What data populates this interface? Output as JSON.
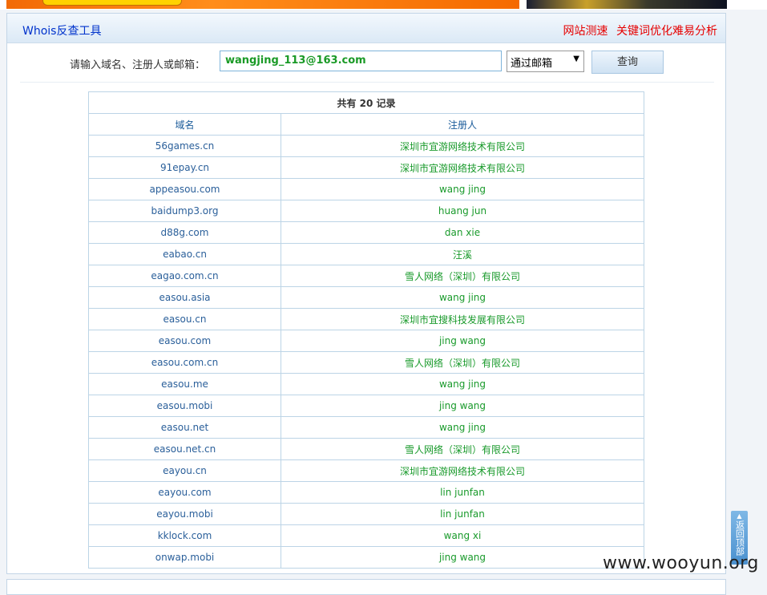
{
  "header": {
    "title": "Whois反查工具",
    "link_speed": "网站测速",
    "link_keyword": "关键词优化难易分析"
  },
  "search": {
    "label": "请输入域名、注册人或邮箱：",
    "value": "wangjing_113@163.com",
    "mode_selected": "通过邮箱",
    "submit_label": "查询"
  },
  "results": {
    "summary": "共有 20 记录",
    "col_domain": "域名",
    "col_registrant": "注册人",
    "rows": [
      {
        "domain": "56games.cn",
        "registrant": "深圳市宜游网络技术有限公司"
      },
      {
        "domain": "91epay.cn",
        "registrant": "深圳市宜游网络技术有限公司"
      },
      {
        "domain": "appeasou.com",
        "registrant": "wang jing"
      },
      {
        "domain": "baidump3.org",
        "registrant": "huang jun"
      },
      {
        "domain": "d88g.com",
        "registrant": "dan xie"
      },
      {
        "domain": "eabao.cn",
        "registrant": "汪溪"
      },
      {
        "domain": "eagao.com.cn",
        "registrant": "雪人网络（深圳）有限公司"
      },
      {
        "domain": "easou.asia",
        "registrant": "wang jing"
      },
      {
        "domain": "easou.cn",
        "registrant": "深圳市宜搜科技发展有限公司"
      },
      {
        "domain": "easou.com",
        "registrant": "jing wang"
      },
      {
        "domain": "easou.com.cn",
        "registrant": "雪人网络（深圳）有限公司"
      },
      {
        "domain": "easou.me",
        "registrant": "wang jing"
      },
      {
        "domain": "easou.mobi",
        "registrant": "jing wang"
      },
      {
        "domain": "easou.net",
        "registrant": "wang jing"
      },
      {
        "domain": "easou.net.cn",
        "registrant": "雪人网络（深圳）有限公司"
      },
      {
        "domain": "eayou.cn",
        "registrant": "深圳市宜游网络技术有限公司"
      },
      {
        "domain": "eayou.com",
        "registrant": "lin junfan"
      },
      {
        "domain": "eayou.mobi",
        "registrant": "lin junfan"
      },
      {
        "domain": "kklock.com",
        "registrant": "wang xi"
      },
      {
        "domain": "onwap.mobi",
        "registrant": "jing wang"
      }
    ]
  },
  "back_to_top": "返回顶部",
  "watermark": "www.wooyun.org"
}
